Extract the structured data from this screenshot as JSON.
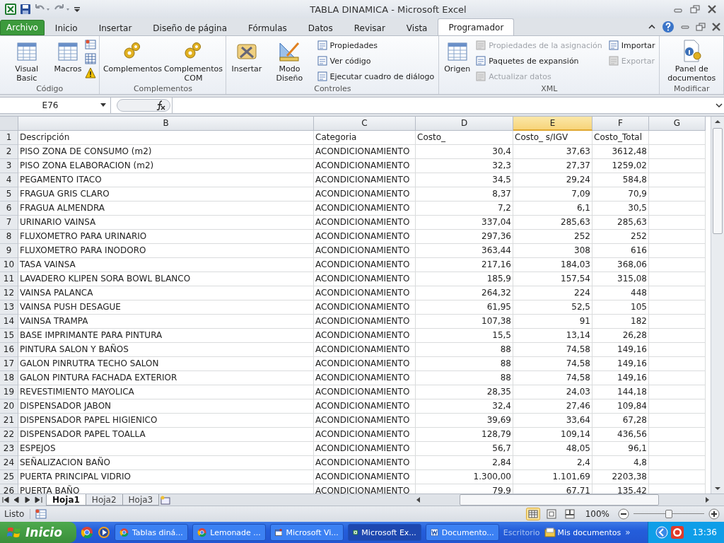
{
  "window": {
    "title": "TABLA DINAMICA  -  Microsoft Excel"
  },
  "ribbon": {
    "tabs": [
      {
        "label": "Archivo",
        "kind": "file",
        "selected": false
      },
      {
        "label": "Inicio",
        "kind": "tab",
        "selected": false
      },
      {
        "label": "Insertar",
        "kind": "tab",
        "selected": false
      },
      {
        "label": "Diseño de página",
        "kind": "tab",
        "selected": false
      },
      {
        "label": "Fórmulas",
        "kind": "tab",
        "selected": false
      },
      {
        "label": "Datos",
        "kind": "tab",
        "selected": false
      },
      {
        "label": "Revisar",
        "kind": "tab",
        "selected": false
      },
      {
        "label": "Vista",
        "kind": "tab",
        "selected": false
      },
      {
        "label": "Programador",
        "kind": "tab",
        "selected": true
      }
    ],
    "groups": [
      {
        "label": "Código",
        "items": [
          {
            "label": "Visual Basic",
            "kind": "large",
            "disabled": false
          },
          {
            "label": "Macros",
            "kind": "large",
            "disabled": false
          },
          {
            "kind": "iconcol"
          }
        ]
      },
      {
        "label": "Complementos",
        "items": [
          {
            "label": "Complementos",
            "kind": "large",
            "disabled": false
          },
          {
            "label": "Complementos COM",
            "kind": "large",
            "disabled": false
          }
        ]
      },
      {
        "label": "Controles",
        "items": [
          {
            "label": "Insertar",
            "kind": "large",
            "disabled": false
          },
          {
            "label": "Modo Diseño",
            "kind": "large",
            "disabled": false
          },
          {
            "label": "Propiedades",
            "kind": "small",
            "disabled": false
          },
          {
            "label": "Ver código",
            "kind": "small",
            "disabled": false
          },
          {
            "label": "Ejecutar cuadro de diálogo",
            "kind": "small",
            "disabled": false
          }
        ]
      },
      {
        "label": "XML",
        "items": [
          {
            "label": "Origen",
            "kind": "large",
            "disabled": false
          },
          {
            "label": "Propiedades de la asignación",
            "kind": "small",
            "disabled": true
          },
          {
            "label": "Paquetes de expansión",
            "kind": "small",
            "disabled": false
          },
          {
            "label": "Actualizar datos",
            "kind": "small",
            "disabled": true
          },
          {
            "label": "Importar",
            "kind": "small",
            "disabled": false
          },
          {
            "label": "Exportar",
            "kind": "small",
            "disabled": true
          }
        ]
      },
      {
        "label": "Modificar",
        "items": [
          {
            "label": "Panel de documentos",
            "kind": "large",
            "disabled": false
          }
        ]
      }
    ]
  },
  "formula_bar": {
    "name_box": "E76"
  },
  "sheet": {
    "columns": [
      {
        "label": "B",
        "selected": false
      },
      {
        "label": "C",
        "selected": false
      },
      {
        "label": "D",
        "selected": false
      },
      {
        "label": "E",
        "selected": true
      },
      {
        "label": "F",
        "selected": false
      },
      {
        "label": "G",
        "selected": false
      }
    ],
    "rows": [
      {
        "number": "1",
        "cells": [
          "Descripción",
          "Categoria",
          "Costo_",
          "Costo_ s/IGV",
          "Costo_Total"
        ]
      },
      {
        "number": "2",
        "cells": [
          "PISO ZONA DE CONSUMO (m2)",
          "ACONDICIONAMIENTO",
          "30,4",
          "37,63",
          "3612,48"
        ]
      },
      {
        "number": "3",
        "cells": [
          "PISO ZONA ELABORACION (m2)",
          "ACONDICIONAMIENTO",
          "32,3",
          "27,37",
          "1259,02"
        ]
      },
      {
        "number": "4",
        "cells": [
          "PEGAMENTO ITACO",
          "ACONDICIONAMIENTO",
          "34,5",
          "29,24",
          "584,8"
        ]
      },
      {
        "number": "5",
        "cells": [
          "FRAGUA GRIS CLARO",
          "ACONDICIONAMIENTO",
          "8,37",
          "7,09",
          "70,9"
        ]
      },
      {
        "number": "6",
        "cells": [
          "FRAGUA ALMENDRA",
          "ACONDICIONAMIENTO",
          "7,2",
          "6,1",
          "30,5"
        ]
      },
      {
        "number": "7",
        "cells": [
          "URINARIO VAINSA",
          "ACONDICIONAMIENTO",
          "337,04",
          "285,63",
          "285,63"
        ]
      },
      {
        "number": "8",
        "cells": [
          "FLUXOMETRO PARA URINARIO",
          "ACONDICIONAMIENTO",
          "297,36",
          "252",
          "252"
        ]
      },
      {
        "number": "9",
        "cells": [
          "FLUXOMETRO PARA INODORO",
          "ACONDICIONAMIENTO",
          "363,44",
          "308",
          "616"
        ]
      },
      {
        "number": "10",
        "cells": [
          "TASA VAINSA",
          "ACONDICIONAMIENTO",
          "217,16",
          "184,03",
          "368,06"
        ]
      },
      {
        "number": "11",
        "cells": [
          "LAVADERO KLIPEN SORA BOWL BLANCO",
          "ACONDICIONAMIENTO",
          "185,9",
          "157,54",
          "315,08"
        ]
      },
      {
        "number": "12",
        "cells": [
          "VAINSA PALANCA",
          "ACONDICIONAMIENTO",
          "264,32",
          "224",
          "448"
        ]
      },
      {
        "number": "13",
        "cells": [
          "VAINSA PUSH DESAGUE",
          "ACONDICIONAMIENTO",
          "61,95",
          "52,5",
          "105"
        ]
      },
      {
        "number": "14",
        "cells": [
          "VAINSA TRAMPA",
          "ACONDICIONAMIENTO",
          "107,38",
          "91",
          "182"
        ]
      },
      {
        "number": "15",
        "cells": [
          "BASE IMPRIMANTE PARA PINTURA",
          "ACONDICIONAMIENTO",
          "15,5",
          "13,14",
          "26,28"
        ]
      },
      {
        "number": "16",
        "cells": [
          "PINTURA SALON Y BAÑOS",
          "ACONDICIONAMIENTO",
          "88",
          "74,58",
          "149,16"
        ]
      },
      {
        "number": "17",
        "cells": [
          "GALON PINRUTRA TECHO SALON",
          "ACONDICIONAMIENTO",
          "88",
          "74,58",
          "149,16"
        ]
      },
      {
        "number": "18",
        "cells": [
          "GALON PINTURA FACHADA EXTERIOR",
          "ACONDICIONAMIENTO",
          "88",
          "74,58",
          "149,16"
        ]
      },
      {
        "number": "19",
        "cells": [
          "REVESTIMIENTO MAYOLICA",
          "ACONDICIONAMIENTO",
          "28,35",
          "24,03",
          "144,18"
        ]
      },
      {
        "number": "20",
        "cells": [
          "DISPENSADOR JABON",
          "ACONDICIONAMIENTO",
          "32,4",
          "27,46",
          "109,84"
        ]
      },
      {
        "number": "21",
        "cells": [
          "DISPENSADOR PAPEL HIGIENICO",
          "ACONDICIONAMIENTO",
          "39,69",
          "33,64",
          "67,28"
        ]
      },
      {
        "number": "22",
        "cells": [
          "DISPENSADOR PAPEL TOALLA",
          "ACONDICIONAMIENTO",
          "128,79",
          "109,14",
          "436,56"
        ]
      },
      {
        "number": "23",
        "cells": [
          "ESPEJOS",
          "ACONDICIONAMIENTO",
          "56,7",
          "48,05",
          "96,1"
        ]
      },
      {
        "number": "24",
        "cells": [
          "SEÑALIZACION BAÑO",
          "ACONDICIONAMIENTO",
          "2,84",
          "2,4",
          "4,8"
        ]
      },
      {
        "number": "25",
        "cells": [
          "PUERTA PRINCIPAL VIDRIO",
          "ACONDICIONAMIENTO",
          "1.300,00",
          "1.101,69",
          "2203,38"
        ]
      },
      {
        "number": "26",
        "cells": [
          "PUERTA BAÑO",
          "ACONDICIONAMIENTO",
          "79,9",
          "67,71",
          "135,42"
        ]
      }
    ]
  },
  "sheet_tabs": [
    {
      "label": "Hoja1",
      "selected": true
    },
    {
      "label": "Hoja2",
      "selected": false
    },
    {
      "label": "Hoja3",
      "selected": false
    }
  ],
  "status_bar": {
    "status": "Listo",
    "zoom": "100%",
    "zoom_slider": {
      "level": 0.5
    }
  },
  "taskbar": {
    "start": "Inicio",
    "buttons": [
      {
        "label": "Tablas diná...",
        "kind": "browser",
        "selected": false
      },
      {
        "label": "Lemonade ...",
        "kind": "browser",
        "selected": false
      },
      {
        "label": "Microsoft Vi...",
        "kind": "editor",
        "selected": false
      },
      {
        "label": "Microsoft Ex...",
        "kind": "excel",
        "selected": true
      },
      {
        "label": "Documento...",
        "kind": "word",
        "selected": false
      }
    ],
    "desktop": "Escritorio",
    "more": "»",
    "folder": "Mis documentos",
    "clock": "13:36"
  }
}
